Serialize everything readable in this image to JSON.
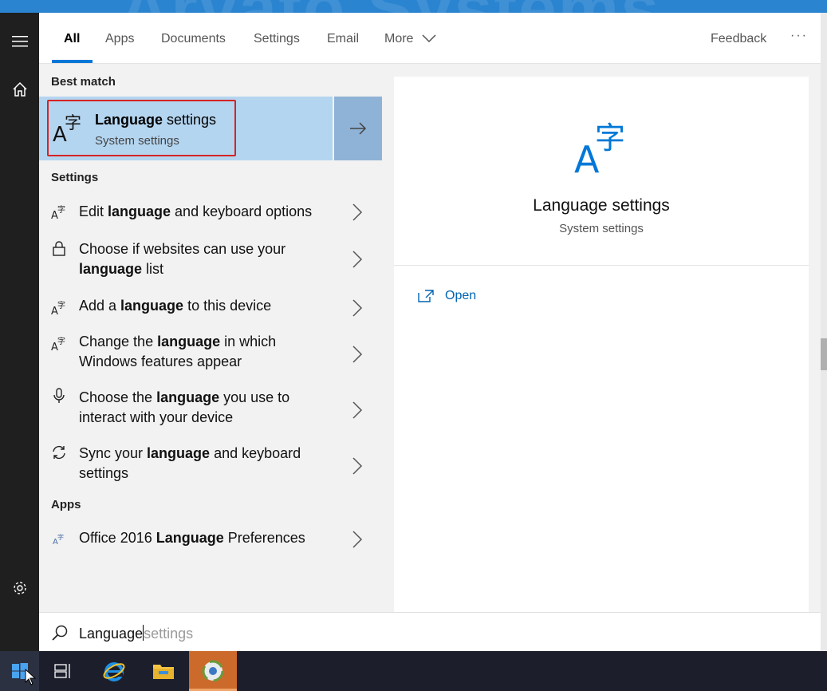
{
  "wallpaper": {
    "text": "Arvato Systems"
  },
  "rail": {
    "menu_icon": "hamburger-icon",
    "home_icon": "home-icon",
    "settings_icon": "gear-icon"
  },
  "tabs": {
    "items": [
      {
        "label": "All",
        "active": true
      },
      {
        "label": "Apps",
        "active": false
      },
      {
        "label": "Documents",
        "active": false
      },
      {
        "label": "Settings",
        "active": false
      },
      {
        "label": "Email",
        "active": false
      },
      {
        "label": "More",
        "active": false
      }
    ],
    "feedback_label": "Feedback",
    "overflow_label": "···"
  },
  "results": {
    "best_match_header": "Best match",
    "best_match": {
      "title_bold": "Language",
      "title_rest": " settings",
      "subtitle": "System settings",
      "icon": "language-icon"
    },
    "settings_header": "Settings",
    "settings_items": [
      {
        "pre": "Edit ",
        "bold": "language",
        "post": " and keyboard options",
        "icon": "language-icon"
      },
      {
        "pre": "Choose if websites can use your ",
        "bold": "language",
        "post": " list",
        "icon": "lock-icon"
      },
      {
        "pre": "Add a ",
        "bold": "language",
        "post": " to this device",
        "icon": "language-icon"
      },
      {
        "pre": "Change the ",
        "bold": "language",
        "post": " in which Windows features appear",
        "icon": "language-icon"
      },
      {
        "pre": "Choose the ",
        "bold": "language",
        "post": " you use to interact with your device",
        "icon": "microphone-icon"
      },
      {
        "pre": "Sync your ",
        "bold": "language",
        "post": " and keyboard settings",
        "icon": "sync-icon"
      }
    ],
    "apps_header": "Apps",
    "apps_items": [
      {
        "pre": "Office 2016 ",
        "bold": "Language",
        "post": " Preferences",
        "icon": "office-language-icon"
      }
    ]
  },
  "preview": {
    "title": "Language settings",
    "subtitle": "System settings",
    "open_label": "Open",
    "icon": "language-icon"
  },
  "search": {
    "typed": "Language",
    "suggestion": "settings"
  },
  "taskbar": {
    "items": [
      "windows-start-icon",
      "task-view-icon",
      "internet-explorer-icon",
      "file-explorer-icon",
      "app-icon"
    ]
  },
  "colors": {
    "accent": "#0078d7",
    "best_match_bg": "#b4d5f0",
    "highlight_border": "#d42424",
    "taskbar": "#1c1f2b"
  }
}
